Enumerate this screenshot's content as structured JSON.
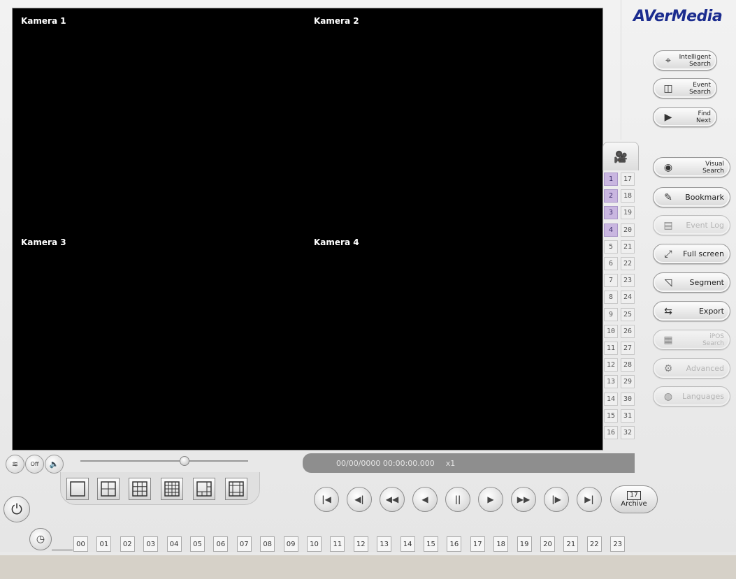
{
  "logo": "AVerMedia",
  "cameras": [
    "Kamera 1",
    "Kamera 2",
    "Kamera 3",
    "Kamera 4"
  ],
  "right_buttons": [
    {
      "label": "Intelligent Search",
      "icon": "intelligent-search-icon",
      "enabled": true
    },
    {
      "label": "Event Search",
      "icon": "event-search-icon",
      "enabled": true
    },
    {
      "label": "Find Next",
      "icon": "find-next-icon",
      "enabled": true
    },
    {
      "label": "Visual Search",
      "icon": "eye-search-icon",
      "enabled": true
    },
    {
      "label": "Bookmark",
      "icon": "bookmark-icon",
      "enabled": true
    },
    {
      "label": "Event Log",
      "icon": "event-log-icon",
      "enabled": false
    },
    {
      "label": "Full screen",
      "icon": "full-screen-icon",
      "enabled": true
    },
    {
      "label": "Segment",
      "icon": "segment-icon",
      "enabled": true
    },
    {
      "label": "Export",
      "icon": "export-icon",
      "enabled": true
    },
    {
      "label": "iPOS Search",
      "icon": "ipos-search-icon",
      "enabled": false
    },
    {
      "label": "Advanced",
      "icon": "advanced-icon",
      "enabled": false
    },
    {
      "label": "Languages",
      "icon": "languages-icon",
      "enabled": false
    }
  ],
  "camera_numbers_left": [
    "1",
    "2",
    "3",
    "4",
    "5",
    "6",
    "7",
    "8",
    "9",
    "10",
    "11",
    "12",
    "13",
    "14",
    "15",
    "16"
  ],
  "camera_numbers_right": [
    "17",
    "18",
    "19",
    "20",
    "21",
    "22",
    "23",
    "24",
    "25",
    "26",
    "27",
    "28",
    "29",
    "30",
    "31",
    "32"
  ],
  "active_cameras": [
    "1",
    "2",
    "3",
    "4"
  ],
  "audio_off_label": "Off",
  "volume_level": 0.62,
  "timestamp": "00/00/0000 00:00:00.000",
  "speed": "x1",
  "playback_buttons": [
    {
      "symbol": "|◀",
      "name": "go-to-start-button"
    },
    {
      "symbol": "◀|",
      "name": "previous-frame-button"
    },
    {
      "symbol": "◀◀",
      "name": "rewind-button"
    },
    {
      "symbol": "◀",
      "name": "reverse-play-button"
    },
    {
      "symbol": "||",
      "name": "pause-button"
    },
    {
      "symbol": "▶",
      "name": "play-button"
    },
    {
      "symbol": "▶▶",
      "name": "fast-forward-button"
    },
    {
      "symbol": "|▶",
      "name": "next-frame-button"
    },
    {
      "symbol": "▶|",
      "name": "go-to-end-button"
    }
  ],
  "archive": {
    "label": "Archive",
    "day": "17"
  },
  "hours": [
    "00",
    "01",
    "02",
    "03",
    "04",
    "05",
    "06",
    "07",
    "08",
    "09",
    "10",
    "11",
    "12",
    "13",
    "14",
    "15",
    "16",
    "17",
    "18",
    "19",
    "20",
    "21",
    "22",
    "23"
  ],
  "colors": {
    "video_bg": "#000000",
    "active_camera": "#c9b6e0",
    "logo": "#1b2c8f"
  }
}
